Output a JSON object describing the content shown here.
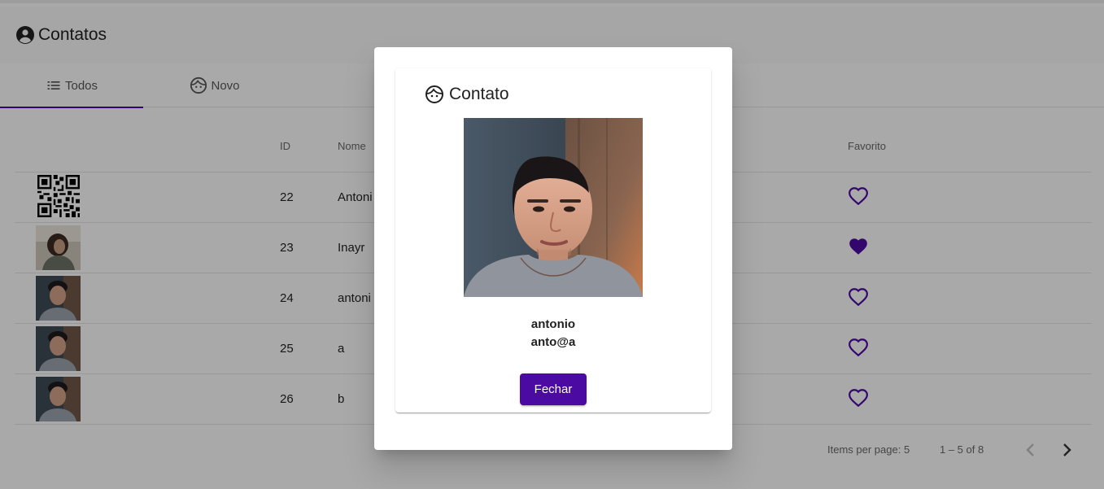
{
  "app": {
    "title": "Contatos"
  },
  "tabs": [
    {
      "label": "Todos",
      "icon": "list-icon",
      "active": true
    },
    {
      "label": "Novo",
      "icon": "face-icon",
      "active": false
    }
  ],
  "table": {
    "headers": {
      "id": "ID",
      "nome": "Nome",
      "favorito": "Favorito"
    },
    "rows": [
      {
        "id": "22",
        "nome": "Antoni",
        "photo": "qr-code",
        "favorito": false
      },
      {
        "id": "23",
        "nome": "Inayr",
        "photo": "photo-woman",
        "favorito": true
      },
      {
        "id": "24",
        "nome": "antoni",
        "photo": "photo-man",
        "favorito": false
      },
      {
        "id": "25",
        "nome": "a",
        "photo": "photo-man",
        "favorito": false
      },
      {
        "id": "26",
        "nome": "b",
        "photo": "photo-man",
        "favorito": false
      }
    ]
  },
  "paginator": {
    "items_per_page_label": "Items per page:",
    "items_per_page": "5",
    "range": "1 – 5 of 8"
  },
  "dialog": {
    "title": "Contato",
    "name": "antonio",
    "email": "anto@a",
    "close_label": "Fechar"
  },
  "colors": {
    "accent": "#4b0aa1",
    "backdrop": "rgba(0,0,0,0.32)"
  }
}
